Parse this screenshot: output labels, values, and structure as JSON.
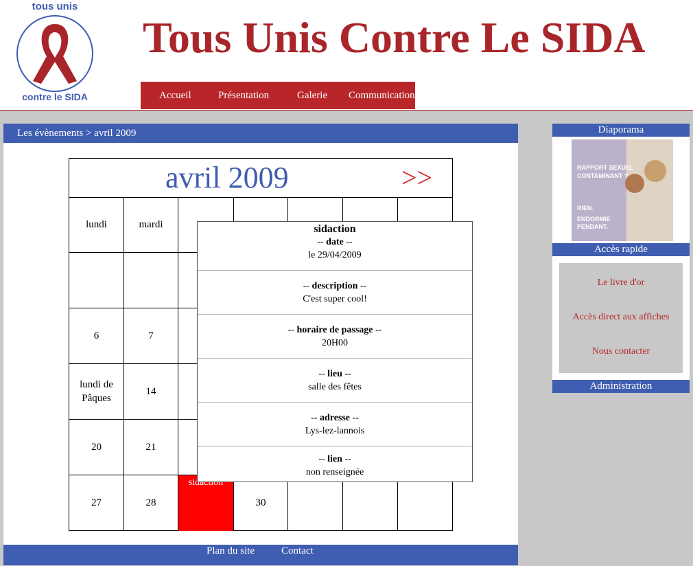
{
  "header": {
    "logo_text_top": "tous unis",
    "logo_text_bottom": "contre le SIDA",
    "title": "Tous Unis Contre Le SIDA",
    "nav": [
      "Accueil",
      "Présentation",
      "Galerie",
      "Communication"
    ]
  },
  "breadcrumb": "Les évènements > avril 2009",
  "calendar": {
    "month": "avril 2009",
    "next": ">>",
    "days": [
      "lundi",
      "mardi",
      "me",
      "",
      "",
      "",
      ""
    ],
    "rows": [
      [
        "",
        "",
        "",
        "",
        "",
        "",
        ""
      ],
      [
        "6",
        "7",
        "",
        "",
        "",
        "",
        ""
      ],
      [
        "lundi de Pâques",
        "14",
        "",
        "",
        "",
        "",
        ""
      ],
      [
        "20",
        "21",
        "",
        "",
        "",
        "",
        ""
      ],
      [
        "27",
        "28",
        "sidaction",
        "30",
        "",
        "",
        ""
      ]
    ]
  },
  "popup": {
    "title": "sidaction",
    "date_label": "date",
    "date_value": "le 29/04/2009",
    "description_label": "description",
    "description_value": "C'est super cool!",
    "horaire_label": "horaire de passage",
    "horaire_value": "20H00",
    "lieu_label": "lieu",
    "lieu_value": "salle des fêtes",
    "adresse_label": "adresse",
    "adresse_value": "Lys-lez-lannois",
    "lien_label": "lien",
    "lien_value": "non renseignée"
  },
  "sidebar": {
    "diaporama": "Diaporama",
    "poster_lines": [
      "RAPPORT SEXUEL",
      "CONTAMINANT ?",
      "RIEN.",
      "ENDORMIE",
      "PENDANT."
    ],
    "acces_rapide": "Accès rapide",
    "links": [
      "Le livre d'or",
      "Accès direct aux affiches",
      "Nous contacter"
    ],
    "administration": "Administration"
  },
  "footer": {
    "plan": "Plan du site",
    "contact": "Contact"
  },
  "colors": {
    "brand_red": "#a8262a",
    "nav_red": "#b8262a",
    "blue": "#3f5db1",
    "gray": "#c8c8c8",
    "event_red": "#ff0000"
  }
}
